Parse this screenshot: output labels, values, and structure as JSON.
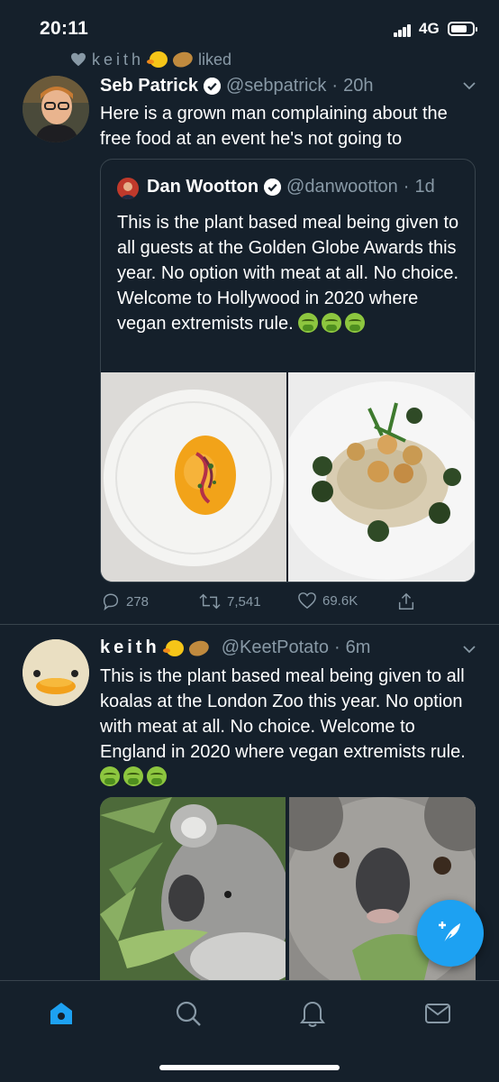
{
  "status_bar": {
    "time": "20:11",
    "network": "4G",
    "battery_level": 0.75,
    "signal_bars": 4
  },
  "colors": {
    "background": "#15202b",
    "accent": "#1da1f2",
    "secondary_text": "#8899a6",
    "divider": "#38444d"
  },
  "social_context": {
    "name": "keith",
    "action": "liked",
    "icon": "heart-icon"
  },
  "tweet1": {
    "display_name": "Seb Patrick",
    "verified": true,
    "handle": "@sebpatrick",
    "separator": "·",
    "time": "20h",
    "text": "Here is a grown man complaining about the free food at an event he's not going to",
    "quote": {
      "display_name": "Dan Wootton",
      "verified": true,
      "handle": "@danwootton",
      "separator": "·",
      "time": "1d",
      "text": "This is the plant based meal being given to all guests at the Golden Globe Awards this year. No option with meat at all. No choice. Welcome to Hollywood in 2020 where vegan extremists rule."
    },
    "actions": {
      "replies": "278",
      "retweets": "7,541",
      "likes": "69.6K"
    }
  },
  "tweet2": {
    "display_name": "keith",
    "handle": "@KeetPotato",
    "separator": "·",
    "time": "6m",
    "text": "This is the plant based meal being given to all koalas at the London Zoo this year. No option with meat at all. No choice. Welcome to England in 2020 where vegan extremists rule."
  },
  "tab_bar": {
    "items": [
      "home-icon",
      "search-icon",
      "notifications-icon",
      "messages-icon"
    ],
    "active": "home-icon"
  },
  "fab": {
    "icon": "compose-tweet-icon"
  }
}
